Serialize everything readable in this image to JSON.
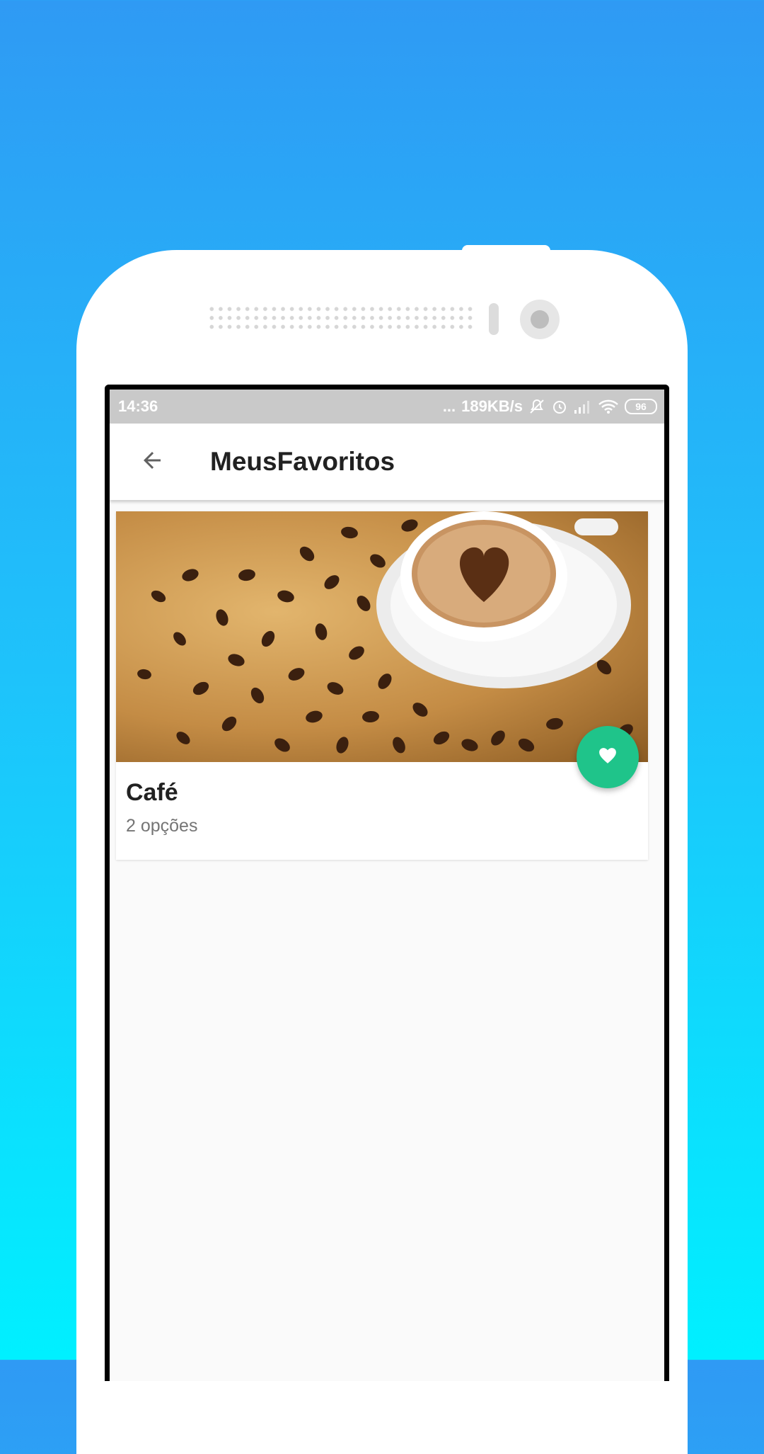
{
  "status_bar": {
    "time": "14:36",
    "dots": "...",
    "network_speed": "189KB/s",
    "battery": "96",
    "icons": [
      "mute-icon",
      "alarm-icon",
      "signal-icon",
      "wifi-icon",
      "battery-icon"
    ]
  },
  "app_bar": {
    "back_icon": "arrow-back-icon",
    "title": "MeusFavoritos"
  },
  "favorites": [
    {
      "title": "Café",
      "subtitle": "2 opções",
      "image": "coffee-cup-with-beans",
      "fab_icon": "heart-icon"
    }
  ],
  "colors": {
    "background_top": "#2f9af4",
    "background_bottom": "#00f0ff",
    "status_bar": "#c9c9c9",
    "fab": "#1fc48a",
    "title_text": "#212121",
    "subtitle_text": "#757575"
  }
}
